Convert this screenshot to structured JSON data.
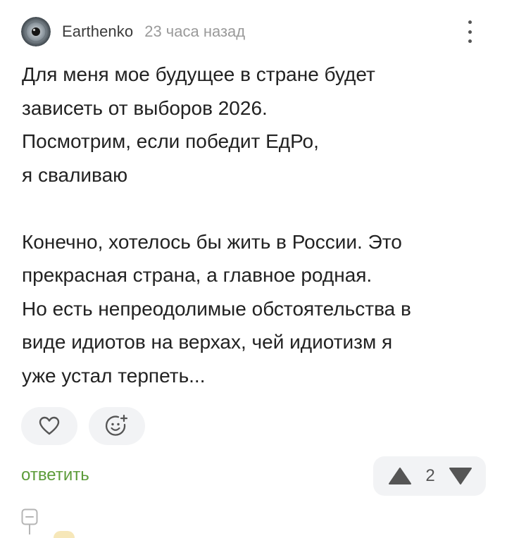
{
  "comment": {
    "author": "Earthenko",
    "timestamp": "23 часа назад",
    "body_lines": [
      "Для меня мое будущее в стране будет",
      "зависеть от выборов 2026.",
      "Посмотрим, если победит ЕдРо,",
      "я сваливаю",
      "",
      "Конечно, хотелось бы жить в России. Это",
      "прекрасная страна, а главное родная.",
      "Но есть непреодолимые обстоятельства в",
      "виде идиотов на верхах, чей идиотизм я",
      "уже устал терпеть..."
    ],
    "reply_label": "ответить",
    "rating": "2"
  },
  "icons": {
    "avatar": "eye-avatar",
    "menu": "more-vertical-icon",
    "like": "heart-icon",
    "react": "add-emoji-icon",
    "upvote": "triangle-up-icon",
    "downvote": "triangle-down-icon",
    "collapse": "collapse-thread-icon"
  },
  "colors": {
    "reply": "#5c9c3a",
    "button_bg": "#f2f3f5",
    "icon": "#555555"
  }
}
